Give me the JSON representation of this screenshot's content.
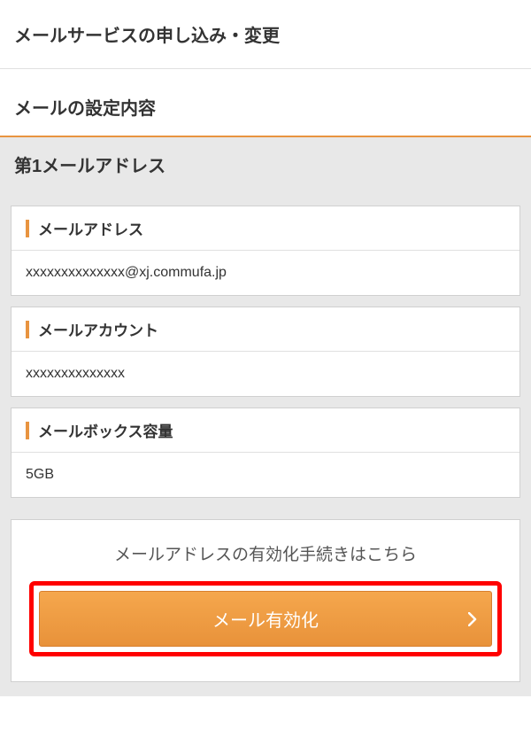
{
  "header": {
    "page_title": "メールサービスの申し込み・変更"
  },
  "section": {
    "title": "メールの設定内容",
    "subsection_title": "第1メールアドレス"
  },
  "fields": {
    "email": {
      "label": "メールアドレス",
      "value": "xxxxxxxxxxxxxx@xj.commufa.jp"
    },
    "account": {
      "label": "メールアカウント",
      "value": "xxxxxxxxxxxxxx"
    },
    "mailbox_capacity": {
      "label": "メールボックス容量",
      "value": "5GB"
    }
  },
  "action": {
    "title": "メールアドレスの有効化手続きはこちら",
    "button_label": "メール有効化"
  }
}
